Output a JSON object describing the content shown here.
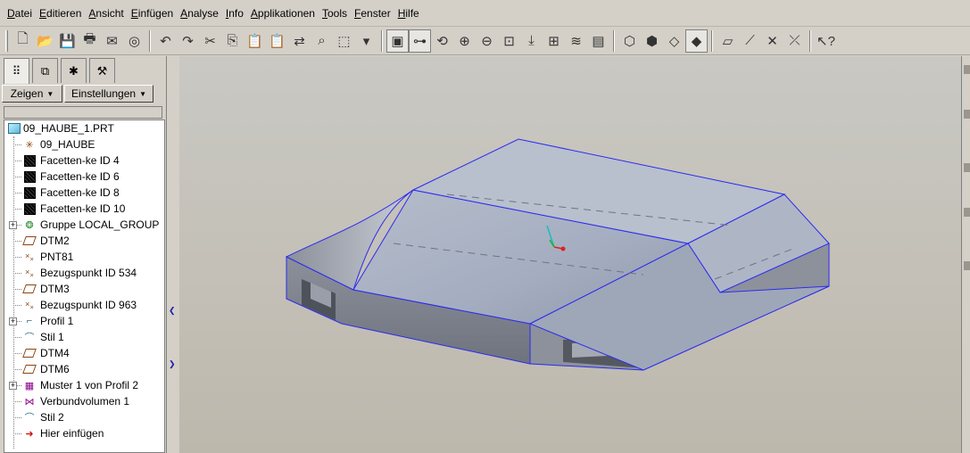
{
  "menu": [
    "Datei",
    "Editieren",
    "Ansicht",
    "Einfügen",
    "Analyse",
    "Info",
    "Applikationen",
    "Tools",
    "Fenster",
    "Hilfe"
  ],
  "toolbar": {
    "groups": [
      [
        {
          "icon": "new-file-icon",
          "glyph": "🗋"
        },
        {
          "icon": "open-folder-icon",
          "glyph": "📂"
        },
        {
          "icon": "save-icon",
          "glyph": "💾"
        },
        {
          "icon": "print-icon",
          "glyph": "🖶"
        },
        {
          "icon": "send-mail-icon",
          "glyph": "✉"
        },
        {
          "icon": "erase-icon",
          "glyph": "◎"
        }
      ],
      [
        {
          "icon": "undo-icon",
          "glyph": "↶"
        },
        {
          "icon": "redo-icon",
          "glyph": "↷"
        },
        {
          "icon": "cut-icon",
          "glyph": "✂"
        },
        {
          "icon": "copy-icon",
          "glyph": "⎘"
        },
        {
          "icon": "paste-icon",
          "glyph": "📋"
        },
        {
          "icon": "paste-special-icon",
          "glyph": "📋"
        },
        {
          "icon": "regenerate-icon",
          "glyph": "⇄"
        },
        {
          "icon": "find-icon",
          "glyph": "⌕"
        },
        {
          "icon": "selection-box-icon",
          "glyph": "⬚"
        },
        {
          "icon": "dropdown-arrow-icon",
          "glyph": "▾"
        }
      ],
      [
        {
          "icon": "repaint-icon",
          "glyph": "▣",
          "active": true
        },
        {
          "icon": "spin-center-icon",
          "glyph": "⊶",
          "active": true
        },
        {
          "icon": "orient-mode-icon",
          "glyph": "⟲"
        },
        {
          "icon": "zoom-in-icon",
          "glyph": "⊕"
        },
        {
          "icon": "zoom-out-icon",
          "glyph": "⊖"
        },
        {
          "icon": "refit-icon",
          "glyph": "⊡"
        },
        {
          "icon": "reorient-icon",
          "glyph": "⤓"
        },
        {
          "icon": "saved-views-icon",
          "glyph": "⊞"
        },
        {
          "icon": "layers-icon",
          "glyph": "≋"
        },
        {
          "icon": "view-manager-icon",
          "glyph": "▤"
        }
      ],
      [
        {
          "icon": "wireframe-icon",
          "glyph": "⬡"
        },
        {
          "icon": "hidden-line-icon",
          "glyph": "⬢"
        },
        {
          "icon": "no-hidden-icon",
          "glyph": "◇"
        },
        {
          "icon": "shading-icon",
          "glyph": "◆",
          "active": true
        }
      ],
      [
        {
          "icon": "datum-planes-icon",
          "glyph": "▱"
        },
        {
          "icon": "datum-axes-icon",
          "glyph": "⟋"
        },
        {
          "icon": "datum-points-icon",
          "glyph": "✕"
        },
        {
          "icon": "coordinate-systems-icon",
          "glyph": "⤫"
        }
      ],
      [
        {
          "icon": "context-help-icon",
          "glyph": "↖?"
        }
      ]
    ]
  },
  "leftpanel": {
    "tabs": [
      "model-tree-tab-icon",
      "layer-tree-tab-icon",
      "favorites-tab-icon",
      "connections-tab-icon"
    ],
    "show_button": "Zeigen",
    "settings_button": "Einstellungen",
    "tree": [
      {
        "label": "09_HAUBE_1.PRT",
        "icon": "part-icon",
        "root": true,
        "expand": false
      },
      {
        "label": "09_HAUBE",
        "icon": "csys-icon",
        "expand": false
      },
      {
        "label": "Facetten-ke ID 4",
        "icon": "facet-icon",
        "expand": false
      },
      {
        "label": "Facetten-ke ID 6",
        "icon": "facet-icon",
        "expand": false
      },
      {
        "label": "Facetten-ke ID 8",
        "icon": "facet-icon",
        "expand": false
      },
      {
        "label": "Facetten-ke ID 10",
        "icon": "facet-icon",
        "expand": false
      },
      {
        "label": "Gruppe LOCAL_GROUP",
        "icon": "group-icon",
        "expand": true
      },
      {
        "label": "DTM2",
        "icon": "datum-plane-icon",
        "expand": false
      },
      {
        "label": "PNT81",
        "icon": "datum-point-icon",
        "expand": false
      },
      {
        "label": "Bezugspunkt ID 534",
        "icon": "datum-point-icon",
        "expand": false
      },
      {
        "label": "DTM3",
        "icon": "datum-plane-icon",
        "expand": false
      },
      {
        "label": "Bezugspunkt ID 963",
        "icon": "datum-point-icon",
        "expand": false
      },
      {
        "label": "Profil 1",
        "icon": "profile-icon",
        "expand": true
      },
      {
        "label": "Stil 1",
        "icon": "style-icon",
        "expand": false
      },
      {
        "label": "DTM4",
        "icon": "datum-plane-icon",
        "expand": false
      },
      {
        "label": "DTM6",
        "icon": "datum-plane-icon",
        "expand": false
      },
      {
        "label": "Muster 1 von Profil 2",
        "icon": "pattern-icon",
        "expand": true
      },
      {
        "label": "Verbundvolumen 1",
        "icon": "blend-icon",
        "expand": false
      },
      {
        "label": "Stil 2",
        "icon": "style-icon",
        "expand": false
      },
      {
        "label": "Hier einfügen",
        "icon": "insert-here-arrow-icon",
        "expand": false
      }
    ]
  },
  "colors": {
    "model_edge": "#2b2bf0",
    "model_top": "#a9b2c4",
    "model_side": "#7f8390",
    "background_top": "#c9c8c3",
    "background_bottom": "#bdb8ac"
  }
}
